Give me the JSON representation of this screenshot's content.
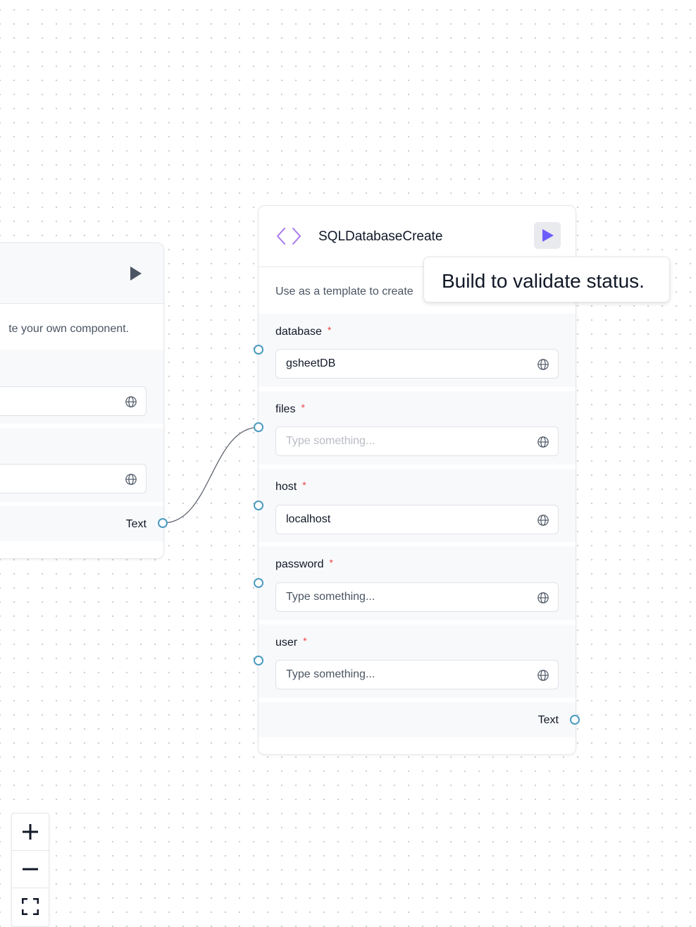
{
  "left_node": {
    "description_partial": "te your own component.",
    "output_label": "Text"
  },
  "node": {
    "title": "SQLDatabaseCreate",
    "description": "Use as a template to create",
    "fields": [
      {
        "label": "database",
        "value": "gsheetDB",
        "placeholder": ""
      },
      {
        "label": "files",
        "value": "",
        "placeholder": "Type something..."
      },
      {
        "label": "host",
        "value": "localhost",
        "placeholder": ""
      },
      {
        "label": "password",
        "value": "",
        "placeholder": "Type something..."
      },
      {
        "label": "user",
        "value": "",
        "placeholder": "Type something..."
      }
    ],
    "output_label": "Text"
  },
  "tooltip": {
    "text": "Build to validate status."
  },
  "colors": {
    "accent": "#6d5dfc",
    "code_icon": "#a779e9",
    "handle": "#4b9bc0",
    "required": "#ef4444"
  },
  "icons": {
    "code": "code-brackets-icon",
    "play": "play-icon",
    "globe": "globe-icon",
    "zoom_in": "plus-icon",
    "zoom_out": "minus-icon",
    "fit": "fit-view-icon"
  }
}
